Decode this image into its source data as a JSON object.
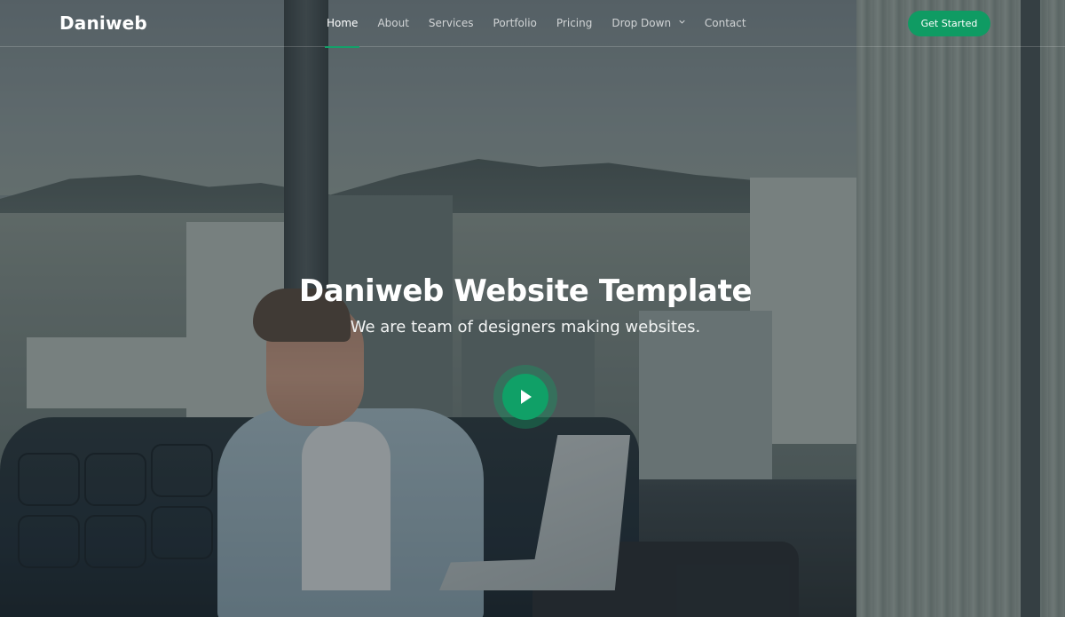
{
  "header": {
    "logo": "Daniweb",
    "nav": [
      {
        "label": "Home",
        "active": true
      },
      {
        "label": "About",
        "active": false
      },
      {
        "label": "Services",
        "active": false
      },
      {
        "label": "Portfolio",
        "active": false
      },
      {
        "label": "Pricing",
        "active": false
      },
      {
        "label": "Drop Down",
        "active": false,
        "has_dropdown": true
      },
      {
        "label": "Contact",
        "active": false
      }
    ],
    "cta_label": "Get Started"
  },
  "hero": {
    "title": "Daniweb Website Template",
    "subtitle": "We are team of designers making websites.",
    "play_icon": "play-icon"
  },
  "colors": {
    "accent": "#0f9b63",
    "text": "#ffffff"
  }
}
